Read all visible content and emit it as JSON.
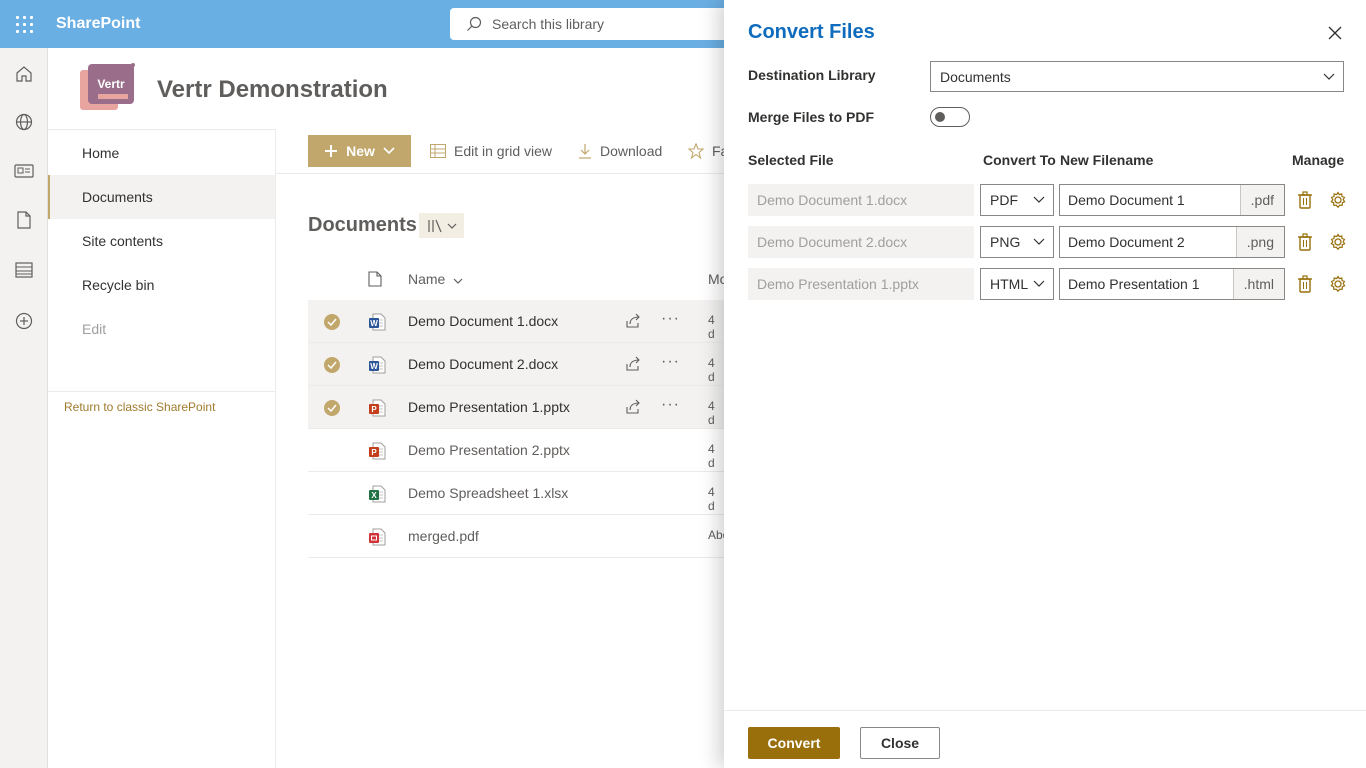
{
  "suite": {
    "brand": "SharePoint",
    "search_placeholder": "Search this library"
  },
  "site": {
    "title": "Vertr Demonstration",
    "logo_text": "Vertr"
  },
  "leftnav": {
    "items": [
      {
        "label": "Home"
      },
      {
        "label": "Documents"
      },
      {
        "label": "Site contents"
      },
      {
        "label": "Recycle bin"
      },
      {
        "label": "Edit"
      }
    ],
    "return_link": "Return to classic SharePoint"
  },
  "commandbar": {
    "new_label": "New",
    "grid_label": "Edit in grid view",
    "download_label": "Download",
    "fav_label": "Fa"
  },
  "library": {
    "title": "Documents",
    "columns": {
      "name": "Name",
      "modified": "Mo"
    },
    "files": [
      {
        "name": "Demo Document 1.docx",
        "type": "word",
        "modified": "4 d",
        "selected": true
      },
      {
        "name": "Demo Document 2.docx",
        "type": "word",
        "modified": "4 d",
        "selected": true
      },
      {
        "name": "Demo Presentation 1.pptx",
        "type": "ppt",
        "modified": "4 d",
        "selected": true
      },
      {
        "name": "Demo Presentation 2.pptx",
        "type": "ppt",
        "modified": "4 d",
        "selected": false
      },
      {
        "name": "Demo Spreadsheet 1.xlsx",
        "type": "excel",
        "modified": "4 d",
        "selected": false
      },
      {
        "name": "merged.pdf",
        "type": "pdf",
        "modified": "Abo",
        "selected": false
      }
    ]
  },
  "panel": {
    "title": "Convert Files",
    "destination_label": "Destination Library",
    "destination_value": "Documents",
    "merge_label": "Merge Files to PDF",
    "merge_on": false,
    "headers": {
      "selected": "Selected File",
      "convert_to": "Convert To",
      "new_filename": "New Filename",
      "manage": "Manage"
    },
    "rows": [
      {
        "file": "Demo Document 1.docx",
        "format": "PDF",
        "filename": "Demo Document 1",
        "ext": ".pdf"
      },
      {
        "file": "Demo Document 2.docx",
        "format": "PNG",
        "filename": "Demo Document 2",
        "ext": ".png"
      },
      {
        "file": "Demo Presentation 1.pptx",
        "format": "HTML",
        "filename": "Demo Presentation 1",
        "ext": ".html"
      }
    ],
    "convert_label": "Convert",
    "close_label": "Close"
  },
  "colors": {
    "suitebar": "#6aafe3",
    "accent": "#c2a76d",
    "primary_button": "#986f0b",
    "panel_title": "#0f6cbd"
  }
}
